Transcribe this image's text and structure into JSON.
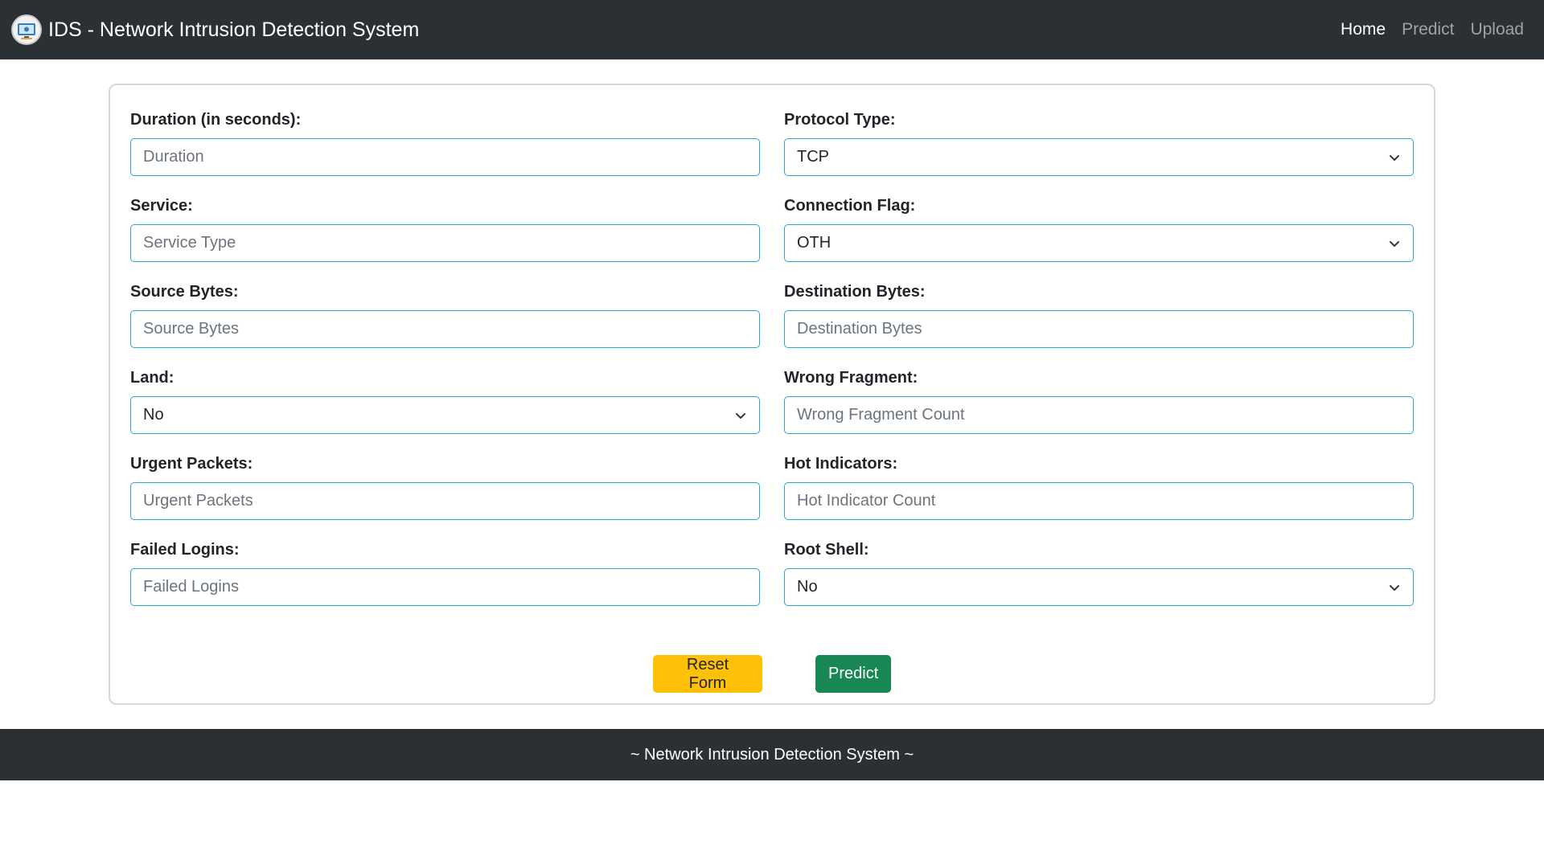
{
  "navbar": {
    "title": "IDS - Network Intrusion Detection System",
    "links": [
      {
        "label": "Home",
        "active": true
      },
      {
        "label": "Predict",
        "active": false
      },
      {
        "label": "Upload",
        "active": false
      }
    ]
  },
  "form": {
    "duration": {
      "label": "Duration (in seconds):",
      "placeholder": "Duration"
    },
    "protocol": {
      "label": "Protocol Type:",
      "value": "TCP"
    },
    "service": {
      "label": "Service:",
      "placeholder": "Service Type"
    },
    "flag": {
      "label": "Connection Flag:",
      "value": "OTH"
    },
    "src_bytes": {
      "label": "Source Bytes:",
      "placeholder": "Source Bytes"
    },
    "dst_bytes": {
      "label": "Destination Bytes:",
      "placeholder": "Destination Bytes"
    },
    "land": {
      "label": "Land:",
      "value": "No"
    },
    "wrong_fragment": {
      "label": "Wrong Fragment:",
      "placeholder": "Wrong Fragment Count"
    },
    "urgent": {
      "label": "Urgent Packets:",
      "placeholder": "Urgent Packets"
    },
    "hot": {
      "label": "Hot Indicators:",
      "placeholder": "Hot Indicator Count"
    },
    "failed_logins": {
      "label": "Failed Logins:",
      "placeholder": "Failed Logins"
    },
    "root_shell": {
      "label": "Root Shell:",
      "value": "No"
    }
  },
  "buttons": {
    "reset_label": "Reset Form",
    "predict_label": "Predict"
  },
  "footer": {
    "text": "~ Network Intrusion Detection System ~"
  },
  "colors": {
    "navbar_bg": "#2b3035",
    "input_border": "#2aa3d6",
    "reset_button": "#ffc107",
    "predict_button": "#198754"
  },
  "icons": {
    "logo": "shield-monitor-icon",
    "select_arrow": "chevron-down-icon"
  }
}
